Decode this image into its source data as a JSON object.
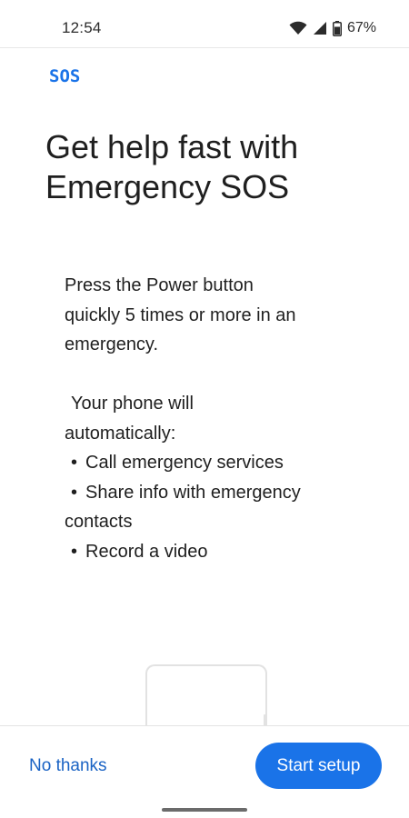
{
  "status_bar": {
    "time": "12:54",
    "battery_percent": "67%",
    "icons": [
      "wifi-icon",
      "cellular-signal-icon",
      "battery-icon"
    ]
  },
  "header": {
    "logo_text": "SOS",
    "logo_color": "#1a73e8"
  },
  "title": {
    "line1": "Get help fast with",
    "line2": "Emergency SOS"
  },
  "body": {
    "line1": "Press the Power button",
    "line2": "quickly 5 times or more in an",
    "line3": "emergency.",
    "intro_line1": "Your phone will",
    "intro_line2": "automatically:",
    "bullets": [
      "Call emergency services",
      "Share info with emergency",
      "Record a video"
    ],
    "bullet_2_continuation": "contacts",
    "bullet_char": "•"
  },
  "actions": {
    "secondary_label": "No thanks",
    "primary_label": "Start setup",
    "primary_color": "#1a73e8"
  }
}
